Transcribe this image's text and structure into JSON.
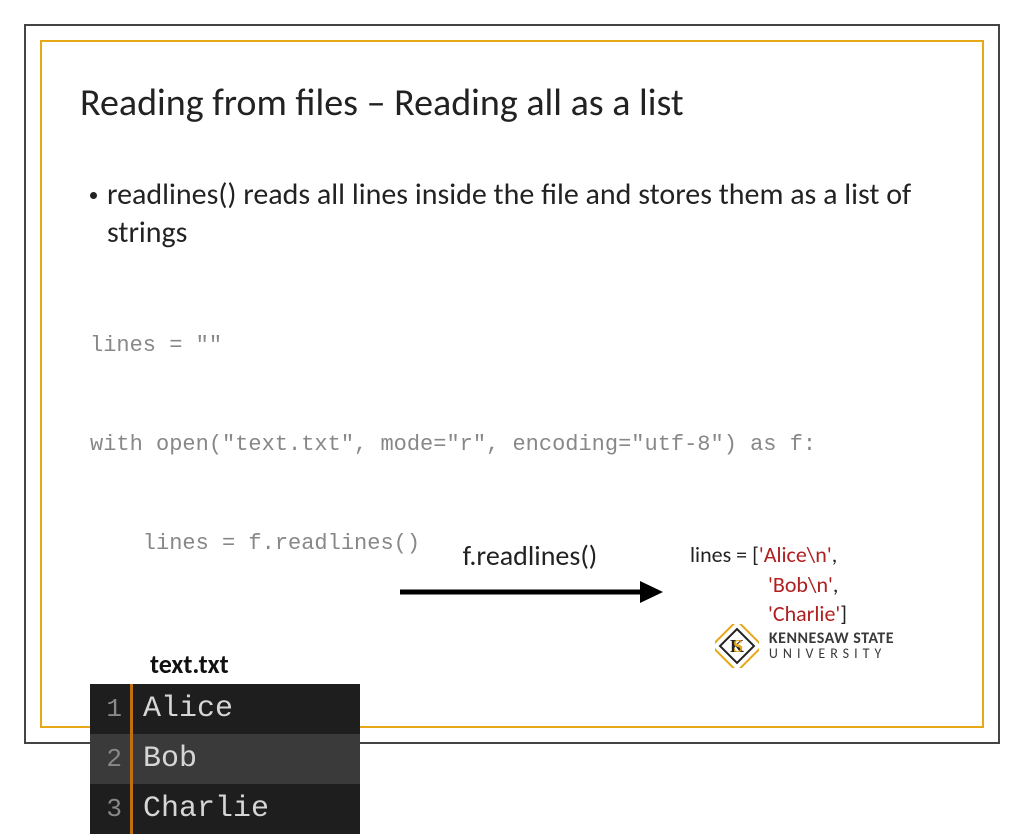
{
  "title": "Reading from files – Reading all as a list",
  "bullet": "readlines() reads all lines inside the file and stores them as a list of strings",
  "code": {
    "l1": "lines = \"\"",
    "l2": "with open(\"text.txt\", mode=\"r\", encoding=\"utf-8\") as f:",
    "l3": "    lines = f.readlines()"
  },
  "filelabel": "text.txt",
  "editor": {
    "rows": [
      {
        "n": "1",
        "t": "Alice"
      },
      {
        "n": "2",
        "t": "Bob"
      },
      {
        "n": "3",
        "t": "Charlie"
      }
    ]
  },
  "arrow_label": "f.readlines()",
  "result": {
    "prefix": "lines = [",
    "items": [
      "'Alice\\n'",
      "'Bob\\n'",
      "'Charlie'"
    ],
    "sep": ",",
    "suffix": "]"
  },
  "logo": {
    "line1": "KENNESAW STATE",
    "line2": "UNIVERSITY"
  }
}
